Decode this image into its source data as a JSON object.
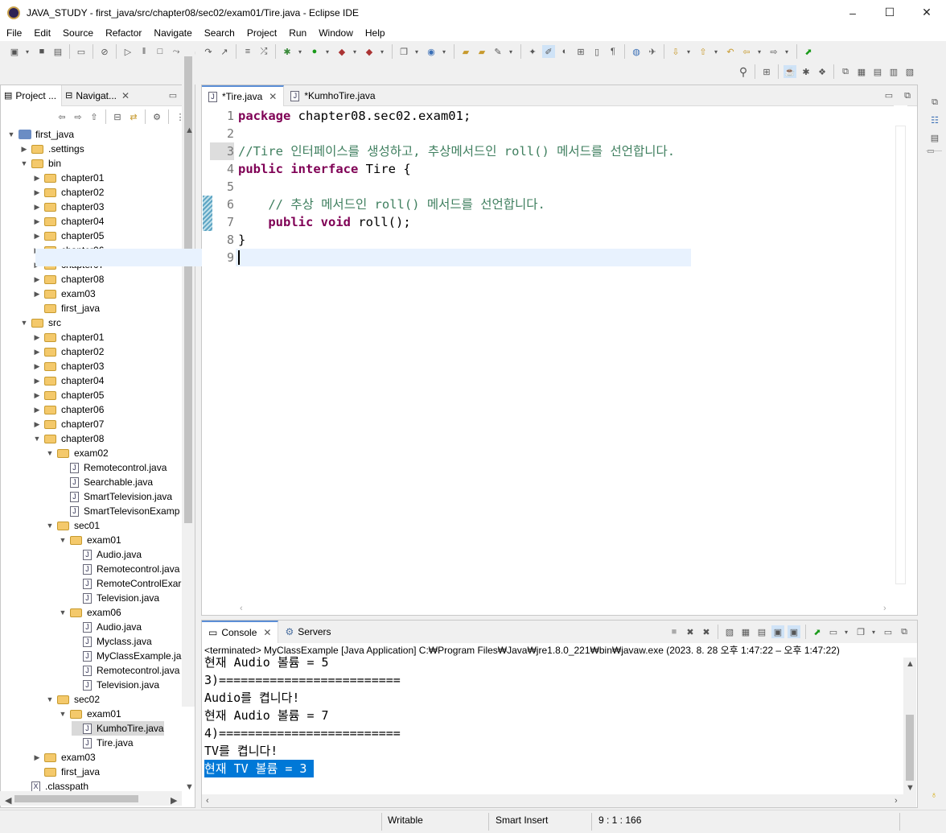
{
  "window": {
    "title": "JAVA_STUDY - first_java/src/chapter08/sec02/exam01/Tire.java - Eclipse IDE",
    "controls": {
      "minimize": "–",
      "maximize": "☐",
      "close": "✕"
    }
  },
  "menu": [
    "File",
    "Edit",
    "Source",
    "Refactor",
    "Navigate",
    "Search",
    "Project",
    "Run",
    "Window",
    "Help"
  ],
  "left_panel": {
    "tabs": [
      {
        "label": "Project ...",
        "icon": "project-explorer-icon"
      },
      {
        "label": "Navigat...",
        "icon": "navigator-icon",
        "close": "✕"
      }
    ],
    "tree": [
      {
        "label": "first_java",
        "depth": 0,
        "type": "project",
        "expanded": true
      },
      {
        "label": ".settings",
        "depth": 1,
        "type": "folder",
        "expanded": false
      },
      {
        "label": "bin",
        "depth": 1,
        "type": "folder",
        "expanded": true
      },
      {
        "label": "chapter01",
        "depth": 2,
        "type": "folder",
        "expanded": false
      },
      {
        "label": "chapter02",
        "depth": 2,
        "type": "folder",
        "expanded": false
      },
      {
        "label": "chapter03",
        "depth": 2,
        "type": "folder",
        "expanded": false
      },
      {
        "label": "chapter04",
        "depth": 2,
        "type": "folder",
        "expanded": false
      },
      {
        "label": "chapter05",
        "depth": 2,
        "type": "folder",
        "expanded": false
      },
      {
        "label": "chapter06",
        "depth": 2,
        "type": "folder",
        "expanded": false
      },
      {
        "label": "chapter07",
        "depth": 2,
        "type": "folder",
        "expanded": false
      },
      {
        "label": "chapter08",
        "depth": 2,
        "type": "folder",
        "expanded": false
      },
      {
        "label": "exam03",
        "depth": 2,
        "type": "folder",
        "expanded": false
      },
      {
        "label": "first_java",
        "depth": 2,
        "type": "folder",
        "leaf": true
      },
      {
        "label": "src",
        "depth": 1,
        "type": "folder",
        "expanded": true
      },
      {
        "label": "chapter01",
        "depth": 2,
        "type": "folder",
        "expanded": false
      },
      {
        "label": "chapter02",
        "depth": 2,
        "type": "folder",
        "expanded": false
      },
      {
        "label": "chapter03",
        "depth": 2,
        "type": "folder",
        "expanded": false
      },
      {
        "label": "chapter04",
        "depth": 2,
        "type": "folder",
        "expanded": false
      },
      {
        "label": "chapter05",
        "depth": 2,
        "type": "folder",
        "expanded": false
      },
      {
        "label": "chapter06",
        "depth": 2,
        "type": "folder",
        "expanded": false
      },
      {
        "label": "chapter07",
        "depth": 2,
        "type": "folder",
        "expanded": false
      },
      {
        "label": "chapter08",
        "depth": 2,
        "type": "folder",
        "expanded": true
      },
      {
        "label": "exam02",
        "depth": 3,
        "type": "folder",
        "expanded": true
      },
      {
        "label": "Remotecontrol.java",
        "depth": 4,
        "type": "java"
      },
      {
        "label": "Searchable.java",
        "depth": 4,
        "type": "java"
      },
      {
        "label": "SmartTelevision.java",
        "depth": 4,
        "type": "java"
      },
      {
        "label": "SmartTelevisonExamp",
        "depth": 4,
        "type": "java"
      },
      {
        "label": "sec01",
        "depth": 3,
        "type": "folder",
        "expanded": true
      },
      {
        "label": "exam01",
        "depth": 4,
        "type": "folder",
        "expanded": true
      },
      {
        "label": "Audio.java",
        "depth": 5,
        "type": "java"
      },
      {
        "label": "Remotecontrol.java",
        "depth": 5,
        "type": "java"
      },
      {
        "label": "RemoteControlExar",
        "depth": 5,
        "type": "java"
      },
      {
        "label": "Television.java",
        "depth": 5,
        "type": "java"
      },
      {
        "label": "exam06",
        "depth": 4,
        "type": "folder",
        "expanded": true
      },
      {
        "label": "Audio.java",
        "depth": 5,
        "type": "java"
      },
      {
        "label": "Myclass.java",
        "depth": 5,
        "type": "java"
      },
      {
        "label": "MyClassExample.ja",
        "depth": 5,
        "type": "java"
      },
      {
        "label": "Remotecontrol.java",
        "depth": 5,
        "type": "java"
      },
      {
        "label": "Television.java",
        "depth": 5,
        "type": "java"
      },
      {
        "label": "sec02",
        "depth": 3,
        "type": "folder",
        "expanded": true
      },
      {
        "label": "exam01",
        "depth": 4,
        "type": "folder",
        "expanded": true
      },
      {
        "label": "KumhoTire.java",
        "depth": 5,
        "type": "java",
        "selected": true
      },
      {
        "label": "Tire.java",
        "depth": 5,
        "type": "java"
      },
      {
        "label": "exam03",
        "depth": 2,
        "type": "folder",
        "expanded": false
      },
      {
        "label": "first_java",
        "depth": 2,
        "type": "folder",
        "leaf": true
      },
      {
        "label": ".classpath",
        "depth": 1,
        "type": "classpath"
      }
    ]
  },
  "editor": {
    "tabs": [
      {
        "label": "*Tire.java",
        "active": true,
        "close": "✕"
      },
      {
        "label": "*KumhoTire.java",
        "active": false
      }
    ],
    "lines": [
      {
        "num": "1",
        "tokens": [
          {
            "t": "package",
            "c": "kw"
          },
          {
            "t": " chapter08.sec02.exam01;",
            "c": ""
          }
        ]
      },
      {
        "num": "2",
        "tokens": []
      },
      {
        "num": "3",
        "tokens": [
          {
            "t": "//Tire 인터페이스를 생성하고, 추상메서드인 roll() 메서드를 선언합니다.",
            "c": "cm"
          }
        ]
      },
      {
        "num": "4",
        "tokens": [
          {
            "t": "public",
            "c": "kw"
          },
          {
            "t": " ",
            "c": ""
          },
          {
            "t": "interface",
            "c": "kw"
          },
          {
            "t": " Tire {",
            "c": ""
          }
        ]
      },
      {
        "num": "5",
        "tokens": []
      },
      {
        "num": "6",
        "tokens": [
          {
            "t": "    ",
            "c": ""
          },
          {
            "t": "// 추상 메서드인 roll() 메서드를 선언합니다.",
            "c": "cm"
          }
        ]
      },
      {
        "num": "7",
        "tokens": [
          {
            "t": "    ",
            "c": ""
          },
          {
            "t": "public",
            "c": "kw"
          },
          {
            "t": " ",
            "c": ""
          },
          {
            "t": "void",
            "c": "kw"
          },
          {
            "t": " roll();",
            "c": ""
          }
        ]
      },
      {
        "num": "8",
        "tokens": [
          {
            "t": "}",
            "c": ""
          }
        ]
      },
      {
        "num": "9",
        "tokens": []
      }
    ]
  },
  "console": {
    "tabs": [
      {
        "label": "Console",
        "active": true,
        "close": "✕"
      },
      {
        "label": "Servers",
        "active": false
      }
    ],
    "description": "<terminated> MyClassExample [Java Application] C:₩Program Files₩Java₩jre1.8.0_221₩bin₩javaw.exe  (2023. 8. 28 오후 1:47:22 – 오후 1:47:22)",
    "lines": [
      {
        "text": "현재 Audio 볼륨 = 5"
      },
      {
        "text": "3)========================="
      },
      {
        "text": "Audio를 켭니다!"
      },
      {
        "text": "현재 Audio 볼륨 = 7"
      },
      {
        "text": "4)========================="
      },
      {
        "text": "TV를 켭니다!"
      },
      {
        "text": "현재 TV 볼륨 = 3 ",
        "highlighted": true
      }
    ]
  },
  "status_bar": {
    "writable": "Writable",
    "insert_mode": "Smart Insert",
    "position": "9 : 1 : 166"
  }
}
